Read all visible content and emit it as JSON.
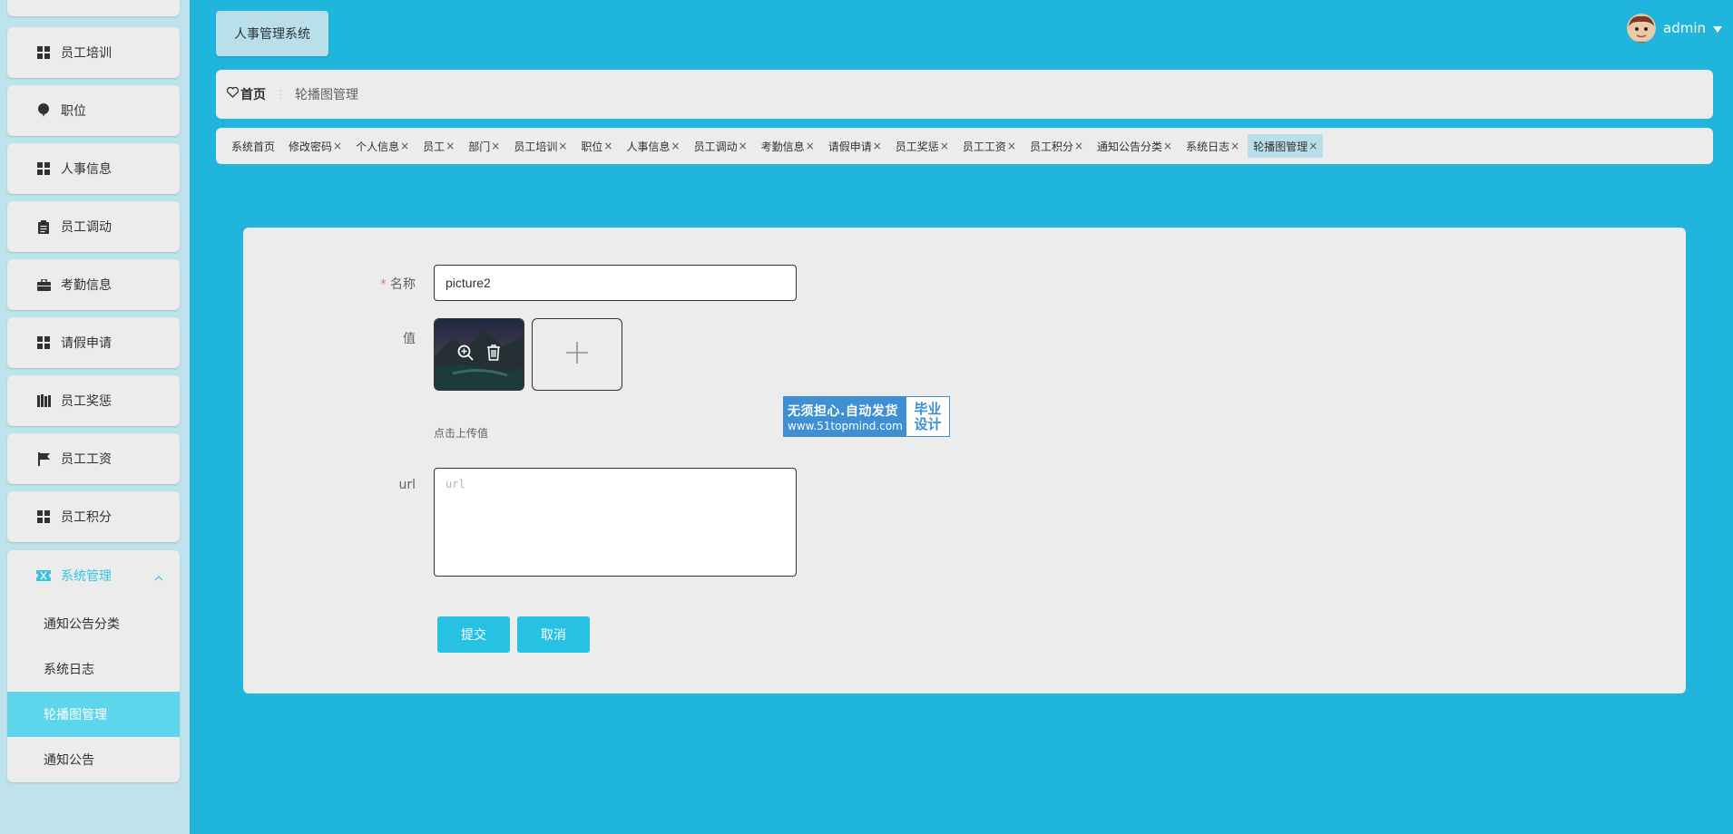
{
  "header": {
    "app_title": "人事管理系统",
    "username": "admin"
  },
  "sidebar": {
    "items": [
      {
        "label": "员工培训",
        "icon": "grid-icon"
      },
      {
        "label": "职位",
        "icon": "balloon-icon"
      },
      {
        "label": "人事信息",
        "icon": "grid-icon"
      },
      {
        "label": "员工调动",
        "icon": "clipboard-icon"
      },
      {
        "label": "考勤信息",
        "icon": "briefcase-icon"
      },
      {
        "label": "请假申请",
        "icon": "grid-icon"
      },
      {
        "label": "员工奖惩",
        "icon": "books-icon"
      },
      {
        "label": "员工工资",
        "icon": "flag-icon"
      },
      {
        "label": "员工积分",
        "icon": "grid-icon"
      }
    ],
    "system_menu": {
      "label": "系统管理",
      "icon": "ticket-icon",
      "expanded": true,
      "children": [
        {
          "label": "通知公告分类"
        },
        {
          "label": "系统日志"
        },
        {
          "label": "轮播图管理",
          "selected": true
        },
        {
          "label": "通知公告"
        }
      ]
    }
  },
  "breadcrumb": {
    "home": "首页",
    "current": "轮播图管理"
  },
  "tags": [
    {
      "label": "系统首页",
      "closable": false
    },
    {
      "label": "修改密码",
      "closable": true
    },
    {
      "label": "个人信息",
      "closable": true
    },
    {
      "label": "员工",
      "closable": true
    },
    {
      "label": "部门",
      "closable": true
    },
    {
      "label": "员工培训",
      "closable": true
    },
    {
      "label": "职位",
      "closable": true
    },
    {
      "label": "人事信息",
      "closable": true
    },
    {
      "label": "员工调动",
      "closable": true
    },
    {
      "label": "考勤信息",
      "closable": true
    },
    {
      "label": "请假申请",
      "closable": true
    },
    {
      "label": "员工奖惩",
      "closable": true
    },
    {
      "label": "员工工资",
      "closable": true
    },
    {
      "label": "员工积分",
      "closable": true
    },
    {
      "label": "通知公告分类",
      "closable": true
    },
    {
      "label": "系统日志",
      "closable": true
    },
    {
      "label": "轮播图管理",
      "closable": true,
      "active": true
    }
  ],
  "form": {
    "name_label": "名称",
    "name_value": "picture2",
    "value_label": "值",
    "upload_hint": "点击上传值",
    "url_label": "url",
    "url_placeholder": "url",
    "submit_label": "提交",
    "cancel_label": "取消"
  },
  "watermark": {
    "line1": "无须担心.自动发货",
    "line2": "www.51topmind.com",
    "right_line1": "毕业",
    "right_line2": "设计"
  },
  "colors": {
    "background": "#1fb5dd",
    "sidebar_bg": "#bfe3ec",
    "card_bg": "#ececec",
    "accent": "#27c2e3",
    "selected_sub": "#5dd5ea",
    "active_tag": "#b9e0ea"
  },
  "tag_close_glyph": "×"
}
